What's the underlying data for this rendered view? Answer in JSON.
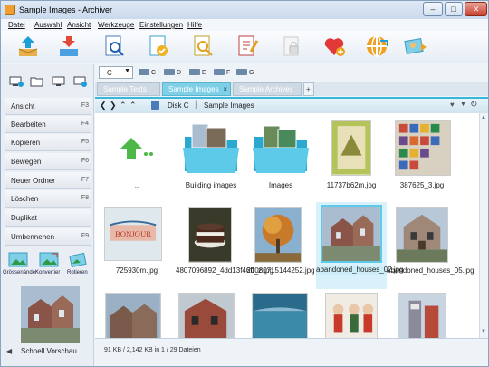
{
  "window": {
    "title": "Sample Images - Archiver"
  },
  "menu": [
    "Datei",
    "Auswahl",
    "Ansicht",
    "Werkzeuge",
    "Einstellungen",
    "Hilfe"
  ],
  "drives": {
    "selected": "C",
    "list": [
      "C",
      "D",
      "E",
      "F",
      "G"
    ]
  },
  "tabs": [
    {
      "label": "Sample Texts"
    },
    {
      "label": "Sample Images",
      "close": "×"
    },
    {
      "label": "Sample Archives"
    }
  ],
  "path": [
    "Disk C",
    "Sample Images"
  ],
  "functions": [
    {
      "label": "Ansicht",
      "key": "F3"
    },
    {
      "label": "Bearbeiten",
      "key": "F4"
    },
    {
      "label": "Kopieren",
      "key": "F5"
    },
    {
      "label": "Bewegen",
      "key": "F6"
    },
    {
      "label": "Neuer Ordner",
      "key": "F7"
    },
    {
      "label": "Löschen",
      "key": "F8"
    },
    {
      "label": "Duplikat",
      "key": ""
    },
    {
      "label": "Umbennenen",
      "key": "F9"
    }
  ],
  "quick_actions": [
    "Grössenänder",
    "Konvertier",
    "Rotieren"
  ],
  "preview_label": "Schnell Vorschau",
  "files": [
    {
      "name": ".."
    },
    {
      "name": "Building images"
    },
    {
      "name": "Images"
    },
    {
      "name": "11737b62m.jpg"
    },
    {
      "name": "387625_3.jpg"
    },
    {
      "name": "725930m.jpg"
    },
    {
      "name": "4807096892_4dd13f46ff_z.jpg"
    },
    {
      "name": "20080715144252.jpg"
    },
    {
      "name": "abandoned_houses_02.jpg"
    },
    {
      "name": "abandoned_houses_05.jpg"
    }
  ],
  "status": "91 KB / 2,142 KB  in  1 / 29 Dateien",
  "colors": {
    "accent": "#38b8d8",
    "selection": "#cdeef8",
    "tab_active": "#7fd0e6"
  }
}
